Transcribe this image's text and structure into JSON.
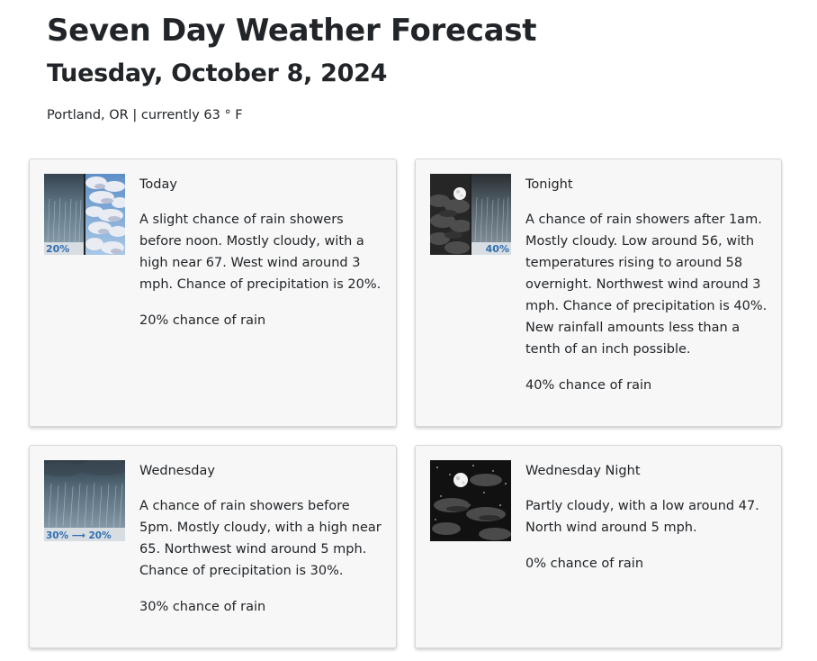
{
  "header": {
    "title": "Seven Day Weather Forecast",
    "date": "Tuesday, October 8, 2024",
    "location_line": "Portland, OR | currently 63 ° F"
  },
  "forecasts": [
    {
      "period": "Today",
      "description": "A slight chance of rain showers before noon. Mostly cloudy, with a high near 67. West wind around 3 mph. Chance of precipitation is 20%.",
      "rain_chance": "20% chance of rain",
      "icon": "rain-showers-then-partly-cloudy-icon",
      "icon_label": "20%"
    },
    {
      "period": "Tonight",
      "description": "A chance of rain showers after 1am. Mostly cloudy. Low around 56, with temperatures rising to around 58 overnight. Northwest wind around 3 mph. Chance of precipitation is 40%. New rainfall amounts less than a tenth of an inch possible.",
      "rain_chance": "40% chance of rain",
      "icon": "night-cloudy-then-rain-icon",
      "icon_label": "40%"
    },
    {
      "period": "Wednesday",
      "description": "A chance of rain showers before 5pm. Mostly cloudy, with a high near 65. Northwest wind around 5 mph. Chance of precipitation is 30%.",
      "rain_chance": "30% chance of rain",
      "icon": "rain-showers-icon",
      "icon_label": "30% ⟶ 20%"
    },
    {
      "period": "Wednesday Night",
      "description": "Partly cloudy, with a low around 47. North wind around 5 mph.",
      "rain_chance": "0% chance of rain",
      "icon": "night-partly-cloudy-icon",
      "icon_label": ""
    }
  ]
}
